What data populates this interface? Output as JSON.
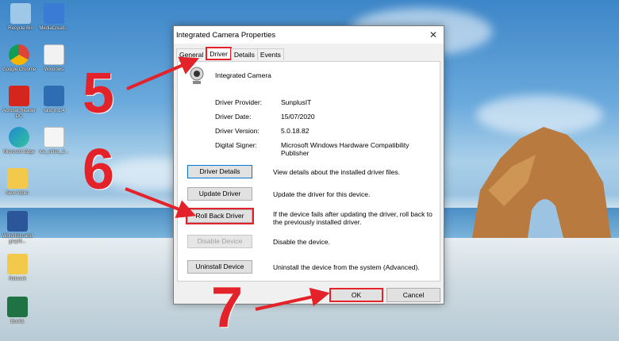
{
  "desktop": {
    "icons": [
      {
        "label": "Recycle Bin",
        "icon": "recycle-bin-icon",
        "color": "#9fc7e8"
      },
      {
        "label": "MediaCreati...",
        "icon": "media-creation-icon",
        "color": "#3a7bd5"
      },
      {
        "label": "Google Chrome",
        "icon": "chrome-icon",
        "color": "#db4437"
      },
      {
        "label": "Windows",
        "icon": "file-icon",
        "color": "#f2f2f2"
      },
      {
        "label": "Acrobat Reader DC",
        "icon": "acrobat-icon",
        "color": "#d4261c"
      },
      {
        "label": "ratio 8.1.4",
        "icon": "usb-icon",
        "color": "#2f6db3"
      },
      {
        "label": "Microsoft Edge",
        "icon": "edge-icon",
        "color": "#1f8ad2"
      },
      {
        "label": "Ice_video_2...",
        "icon": "video-file-icon",
        "color": "#f5f5f5"
      },
      {
        "label": "New folder",
        "icon": "folder-icon",
        "color": "#f3c94b"
      },
      {
        "label": "Word lists and graphi...",
        "icon": "word-icon",
        "color": "#2b579a"
      },
      {
        "label": "Network",
        "icon": "folder-icon",
        "color": "#f3c94b"
      },
      {
        "label": "Book1",
        "icon": "excel-icon",
        "color": "#1f7244"
      }
    ]
  },
  "dialog": {
    "title": "Integrated Camera Properties",
    "tabs": [
      "General",
      "Driver",
      "Details",
      "Events"
    ],
    "active_tab": "Driver",
    "device_name": "Integrated Camera",
    "info": [
      {
        "label": "Driver Provider:",
        "value": "SunplusIT"
      },
      {
        "label": "Driver Date:",
        "value": "15/07/2020"
      },
      {
        "label": "Driver Version:",
        "value": "5.0.18.82"
      },
      {
        "label": "Digital Signer:",
        "value": "Microsoft Windows Hardware Compatibility Publisher"
      }
    ],
    "actions": [
      {
        "label": "Driver Details",
        "desc": "View details about the installed driver files."
      },
      {
        "label": "Update Driver",
        "desc": "Update the driver for this device."
      },
      {
        "label": "Roll Back Driver",
        "desc": "If the device fails after updating the driver, roll back to the previously installed driver."
      },
      {
        "label": "Disable Device",
        "desc": "Disable the device."
      },
      {
        "label": "Uninstall Device",
        "desc": "Uninstall the device from the system (Advanced)."
      }
    ],
    "ok_label": "OK",
    "cancel_label": "Cancel"
  },
  "annotations": {
    "steps": [
      "5",
      "6",
      "7"
    ],
    "color": "#e32229"
  }
}
